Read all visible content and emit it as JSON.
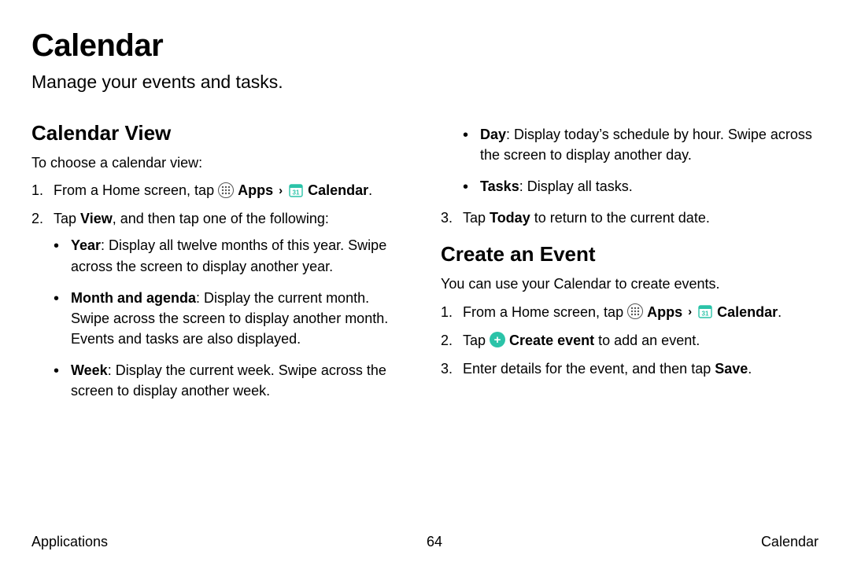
{
  "title": "Calendar",
  "subtitle": "Manage your events and tasks.",
  "section_view": {
    "heading": "Calendar View",
    "intro": "To choose a calendar view:",
    "step1_pre": "From a Home screen, tap ",
    "apps_label": "Apps",
    "calendar_label": "Calendar",
    "step1_post": ".",
    "step2_pre": "Tap ",
    "step2_bold": "View",
    "step2_post": ", and then tap one of the following:",
    "bullets": {
      "year_label": "Year",
      "year_text": ": Display all twelve months of this year. Swipe across the screen to display another year.",
      "month_label": "Month and agenda",
      "month_text": ": Display the current month. Swipe across the screen to display another month. Events and tasks are also displayed.",
      "week_label": "Week",
      "week_text": ": Display the current week. Swipe across the screen to display another week.",
      "day_label": "Day",
      "day_text": ": Display today’s schedule by hour. Swipe across the screen to display another day.",
      "tasks_label": "Tasks",
      "tasks_text": ": Display all tasks."
    },
    "step3_pre": "Tap ",
    "step3_bold": "Today",
    "step3_post": " to return to the current date."
  },
  "section_create": {
    "heading": "Create an Event",
    "intro": "You can use your Calendar to create events.",
    "step1_pre": "From a Home screen, tap ",
    "apps_label": "Apps",
    "calendar_label": "Calendar",
    "step1_post": ".",
    "step2_pre": "Tap ",
    "step2_bold": "Create event",
    "step2_post": " to add an event.",
    "step3_pre": "Enter details for the event, and then tap ",
    "step3_bold": "Save",
    "step3_post": "."
  },
  "footer": {
    "left": "Applications",
    "center": "64",
    "right": "Calendar"
  },
  "icons": {
    "calendar_day": "31"
  }
}
